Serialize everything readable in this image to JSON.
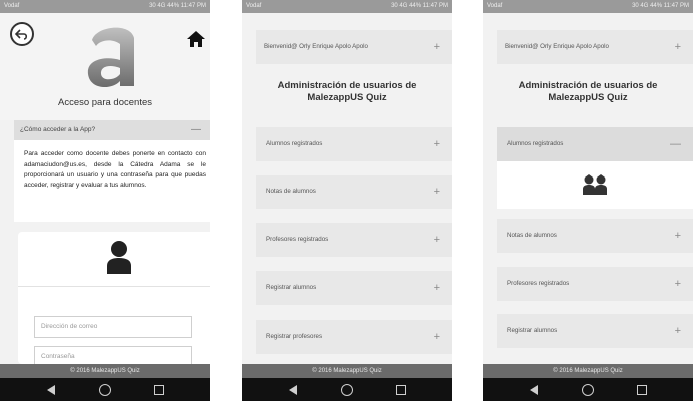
{
  "status_bar": {
    "carrier": "Vodaf",
    "right": "30 4G 44% 11:47 PM"
  },
  "footer": {
    "text": "© 2016 MalezappUS Quiz"
  },
  "phone1": {
    "title": "Acceso para docentes",
    "faq_question": "¿Cómo acceder a la App?",
    "faq_toggle": "—",
    "faq_answer": "Para acceder como docente debes ponerte en contacto con adamaciudon@us.es, desde la Cátedra Adama se le proporcionará un usuario y una contraseña para que puedas acceder, registrar y evaluar a tus alumnos.",
    "email_placeholder": "Dirección de correo",
    "password_placeholder": "Contraseña"
  },
  "phone2": {
    "welcome": "Bienvenid@ Orly Enrique Apolo Apolo",
    "toggle": "+",
    "title_line1": "Administración de usuarios de",
    "title_line2": "MalezappUS Quiz",
    "menu": [
      {
        "label": "Alumnos registrados",
        "toggle": "+"
      },
      {
        "label": "Notas de alumnos",
        "toggle": "+"
      },
      {
        "label": "Profesores registrados",
        "toggle": "+"
      },
      {
        "label": "Registrar alumnos",
        "toggle": "+"
      },
      {
        "label": "Registrar profesores",
        "toggle": "+"
      }
    ]
  },
  "phone3": {
    "welcome": "Bienvenid@ Orly Enrique Apolo Apolo",
    "toggle": "+",
    "title_line1": "Administración de usuarios de",
    "title_line2": "MalezappUS Quiz",
    "menu": [
      {
        "label": "Alumnos registrados",
        "toggle": "—"
      },
      {
        "label": "Notas de alumnos",
        "toggle": "+"
      },
      {
        "label": "Profesores registrados",
        "toggle": "+"
      },
      {
        "label": "Registrar alumnos",
        "toggle": "+"
      }
    ]
  }
}
